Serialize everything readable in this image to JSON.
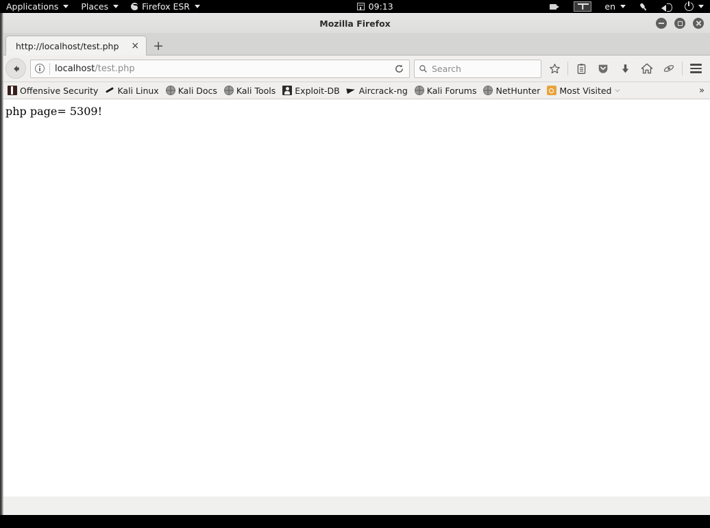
{
  "desktop_panel": {
    "applications_label": "Applications",
    "places_label": "Places",
    "firefox_label": "Firefox ESR",
    "clock": "09:13",
    "workspace": "1",
    "keyboard_layout": "en"
  },
  "window": {
    "title": "Mozilla Firefox",
    "controls": {
      "minimize": "minimize",
      "maximize": "maximize",
      "close": "close"
    }
  },
  "tabs": {
    "items": [
      {
        "title": "http://localhost/test.php",
        "close": "×"
      }
    ],
    "new_tab": "+"
  },
  "navbar": {
    "back": "←",
    "url_host": "localhost",
    "url_path": "/test.php",
    "reload": "↻",
    "search_placeholder": "Search"
  },
  "bookmarks": {
    "items": [
      {
        "label": "Offensive Security",
        "icon": "offsec-favicon"
      },
      {
        "label": "Kali Linux",
        "icon": "wrench-favicon"
      },
      {
        "label": "Kali Docs",
        "icon": "globe-favicon"
      },
      {
        "label": "Kali Tools",
        "icon": "globe-favicon"
      },
      {
        "label": "Exploit-DB",
        "icon": "exploitdb-favicon"
      },
      {
        "label": "Aircrack-ng",
        "icon": "aircrack-favicon"
      },
      {
        "label": "Kali Forums",
        "icon": "globe-favicon"
      },
      {
        "label": "NetHunter",
        "icon": "globe-favicon"
      },
      {
        "label": "Most Visited",
        "icon": "folder-favicon",
        "chevron": "⌵"
      }
    ],
    "overflow": "»"
  },
  "page": {
    "body_text": "php page= 5309!"
  },
  "colors": {
    "panel_bg": "#000000",
    "chrome_bg": "#f0efee",
    "tabstrip_bg": "#d5d5d3",
    "active_tab_bg": "#f2f2f1",
    "page_bg": "#ffffff",
    "accent_orange": "#e8a33d"
  }
}
